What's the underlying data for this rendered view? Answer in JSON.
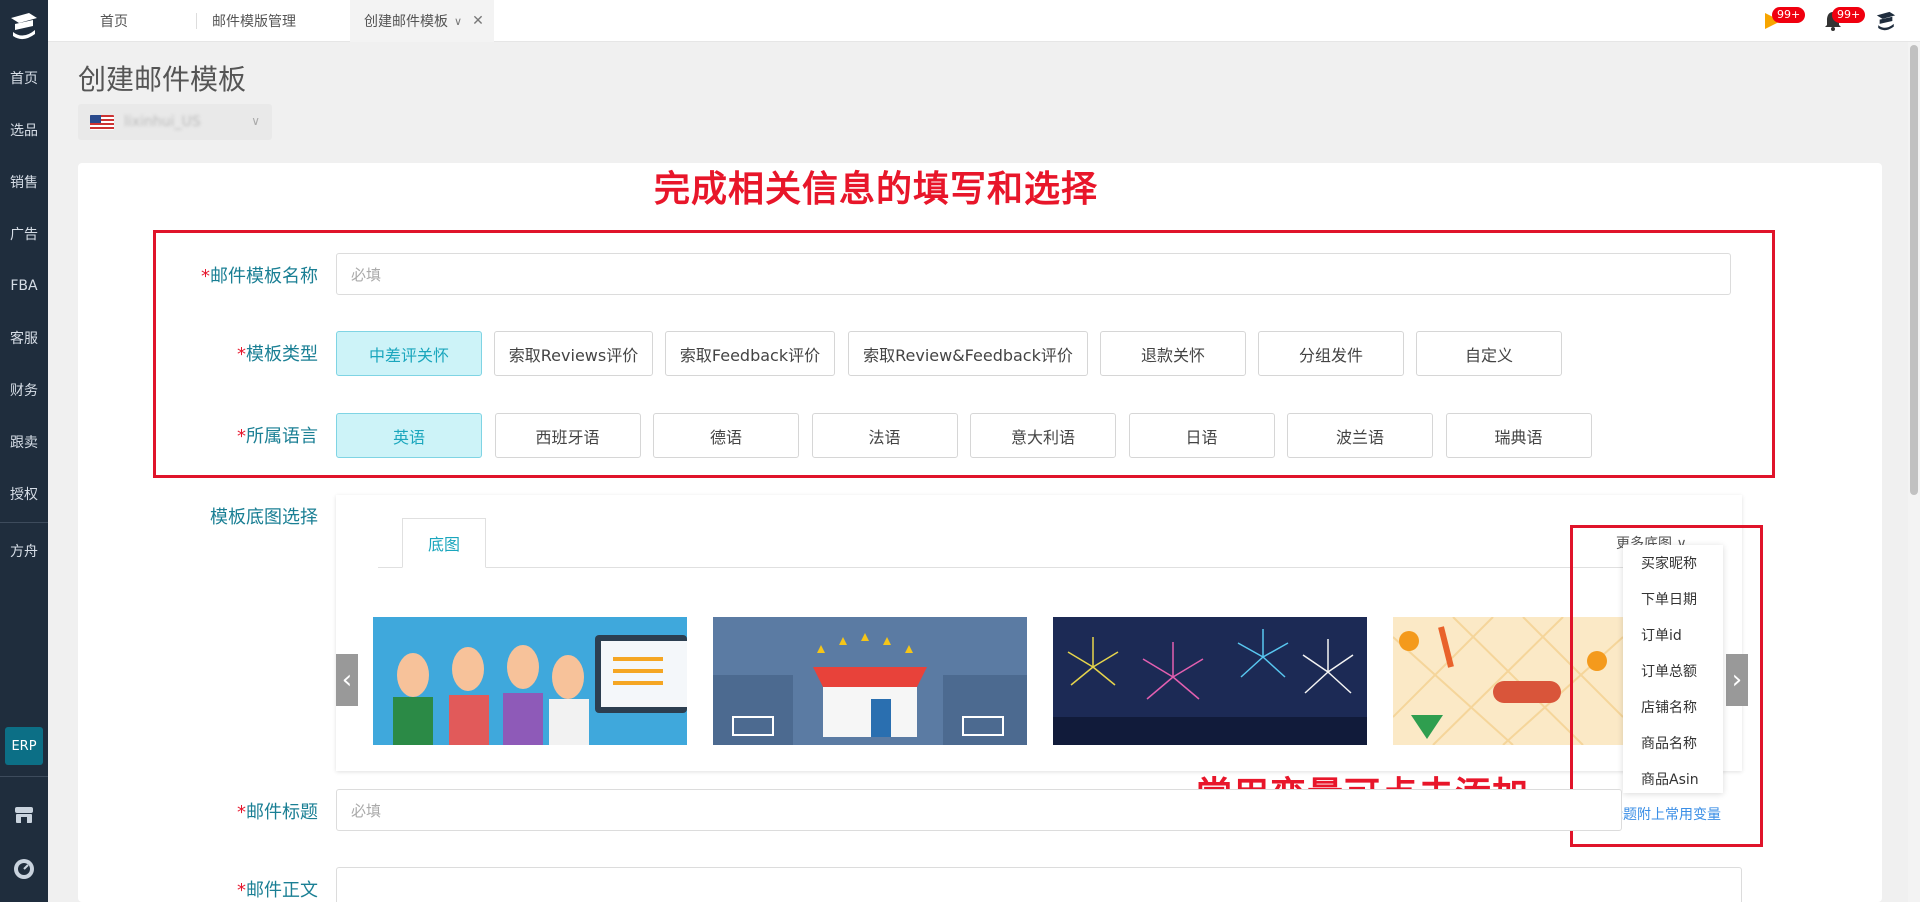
{
  "sidebar": {
    "items": [
      "首页",
      "选品",
      "销售",
      "广告",
      "FBA",
      "客服",
      "财务",
      "跟卖",
      "授权"
    ],
    "extra": "方舟",
    "erp": "ERP"
  },
  "tabs": [
    {
      "label": "首页"
    },
    {
      "label": "邮件模版管理"
    },
    {
      "label": "创建邮件模板"
    }
  ],
  "top_icons": {
    "flag_badge": "99+",
    "bell_badge": "99+"
  },
  "page": {
    "title": "创建邮件模板",
    "store_select": "lixinhui_US"
  },
  "annotations": {
    "top": "完成相关信息的填写和选择",
    "bottom": "常用变量可点击添加"
  },
  "form": {
    "required_mark": "*",
    "name_label": "邮件模板名称",
    "name_placeholder": "必填",
    "type_label": "模板类型",
    "types": [
      "中差评关怀",
      "索取Reviews评价",
      "索取Feedback评价",
      "索取Review&Feedback评价",
      "退款关怀",
      "分组发件",
      "自定义"
    ],
    "type_selected": "中差评关怀",
    "lang_label": "所属语言",
    "langs": [
      "英语",
      "西班牙语",
      "德语",
      "法语",
      "意大利语",
      "日语",
      "波兰语",
      "瑞典语"
    ],
    "lang_selected": "英语",
    "bg_label": "模板底图选择",
    "bg_tab": "底图",
    "more_bg": "更多底图",
    "subject_label": "邮件标题",
    "subject_placeholder": "必填",
    "body_label": "邮件正文"
  },
  "variables": {
    "items": [
      "买家昵称",
      "下单日期",
      "订单id",
      "订单总额",
      "店铺名称",
      "商品名称",
      "商品Asin"
    ],
    "link": "标题附上常用变量"
  },
  "colors": {
    "sidebar": "#1f2d3d",
    "accent": "#1aa6bd",
    "annotation": "#e0142a",
    "selected_bg": "#cdf3f8"
  }
}
